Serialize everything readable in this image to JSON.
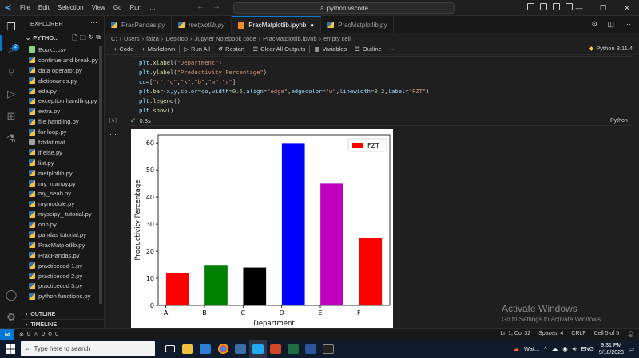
{
  "titlebar": {
    "menu": [
      "File",
      "Edit",
      "Selection",
      "View",
      "Go",
      "Run",
      "…"
    ],
    "search": "python vscode"
  },
  "activity_bar": {
    "badge": "2",
    "icons": [
      "explorer-icon",
      "search-icon",
      "source-control-icon",
      "run-debug-icon",
      "extensions-icon",
      "testing-icon",
      "account-icon",
      "settings-icon"
    ]
  },
  "sidebar": {
    "title": "EXPLORER",
    "folder": "PYTHO...",
    "files": [
      {
        "name": "Book1.csv",
        "type": "csv"
      },
      {
        "name": "continue and break.py",
        "type": "py"
      },
      {
        "name": "data operator.py",
        "type": "py"
      },
      {
        "name": "dictionaries.py",
        "type": "py"
      },
      {
        "name": "eda.py",
        "type": "py"
      },
      {
        "name": "exception handling.py",
        "type": "py"
      },
      {
        "name": "extra.py",
        "type": "py"
      },
      {
        "name": "file handling.py",
        "type": "py"
      },
      {
        "name": "for loop.py",
        "type": "py"
      },
      {
        "name": "fztdot.mat",
        "type": "mat"
      },
      {
        "name": "if else.py",
        "type": "py"
      },
      {
        "name": "list.py",
        "type": "py"
      },
      {
        "name": "metplotlib.py",
        "type": "py"
      },
      {
        "name": "my_numpy.py",
        "type": "py"
      },
      {
        "name": "my_seab.py",
        "type": "py"
      },
      {
        "name": "mymodule.py",
        "type": "py"
      },
      {
        "name": "myscipy_ tutorial.py",
        "type": "py"
      },
      {
        "name": "oop.py",
        "type": "py"
      },
      {
        "name": "pandas tutorial.py",
        "type": "py"
      },
      {
        "name": "PracMatplotlib.py",
        "type": "py"
      },
      {
        "name": "PracPandas.py",
        "type": "py"
      },
      {
        "name": "practicecod 1.py",
        "type": "py"
      },
      {
        "name": "practicecod 2.py",
        "type": "py"
      },
      {
        "name": "practicecod 3.py",
        "type": "py"
      },
      {
        "name": "python functions.py",
        "type": "py"
      }
    ],
    "outline": "OUTLINE",
    "timeline": "TIMELINE"
  },
  "tabs": [
    {
      "label": "PracPandas.py",
      "active": false,
      "italic": false
    },
    {
      "label": "metplotlib.py",
      "active": false,
      "italic": true
    },
    {
      "label": "PracMatplotlib.ipynb",
      "active": true,
      "italic": false,
      "dirty": "●"
    },
    {
      "label": "PracMatplotlib.py",
      "active": false,
      "italic": false
    }
  ],
  "breadcrumb": [
    "C:",
    "Users",
    "faiza",
    "Desktop",
    "Jupyter Notebook code",
    "PracMatplotlib.ipynb",
    "empty cell"
  ],
  "nb_toolbar": {
    "code": "Code",
    "markdown": "Markdown",
    "run_all": "Run All",
    "restart": "Restart",
    "clear_all": "Clear All Outputs",
    "variables": "Variables",
    "outline": "Outline",
    "kernel": "Python 3.11.4"
  },
  "cell": {
    "exec_count": "[6]",
    "time": "0.3s",
    "language": "Python"
  },
  "chart_data": {
    "type": "bar",
    "categories": [
      "A",
      "B",
      "C",
      "D",
      "E",
      "F"
    ],
    "values": [
      12,
      15,
      14,
      60,
      45,
      25
    ],
    "colors": [
      "#ff0000",
      "#008000",
      "#000000",
      "#0000ff",
      "#bf00bf",
      "#ff0000"
    ],
    "xlabel": "Department",
    "ylabel": "Productivity Percentage",
    "ylim": [
      0,
      63
    ],
    "yticks": [
      0,
      10,
      20,
      30,
      40,
      50,
      60
    ],
    "legend": {
      "label": "FZT",
      "placement": "top-right",
      "color": "#ff0000"
    },
    "grid": false
  },
  "watermark": {
    "title": "Activate Windows",
    "subtitle": "Go to Settings to activate Windows."
  },
  "statusbar": {
    "errors": "0",
    "warnings": "0",
    "ports": "0",
    "position": "Ln 1, Col 32",
    "spaces": "Spaces: 4",
    "eol": "CRLF",
    "cell": "Cell 5 of 5"
  },
  "taskbar": {
    "search": "Type here to search",
    "weather": "Wat...",
    "lang": "ENG",
    "time": "9:31 PM",
    "date": "9/18/2023"
  }
}
